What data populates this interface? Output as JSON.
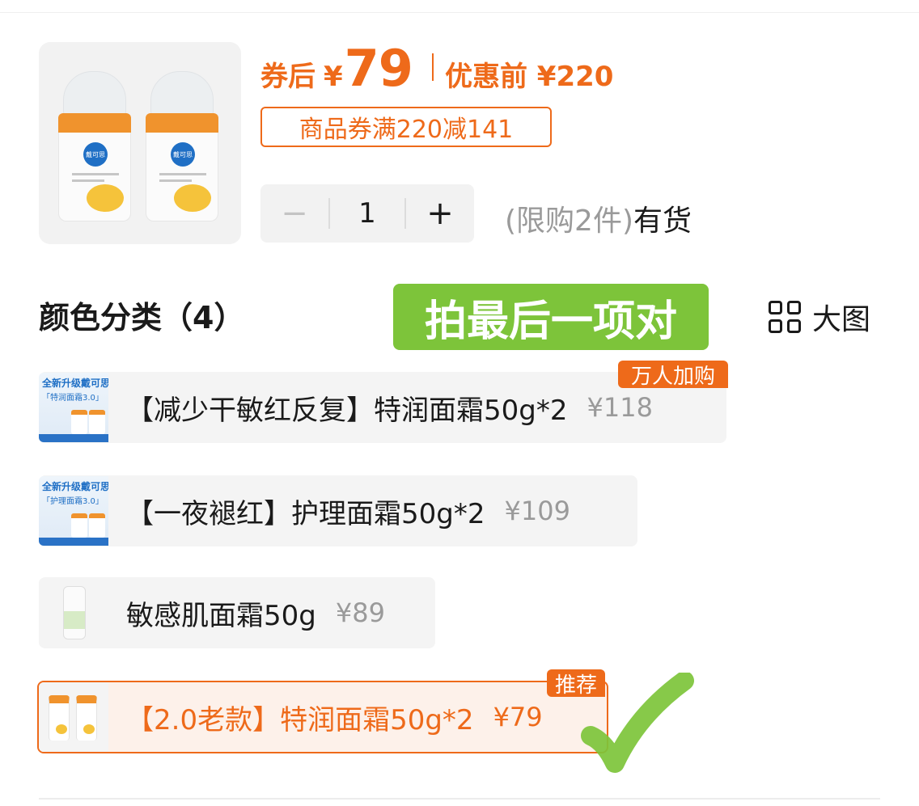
{
  "product": {
    "brand_label": "戴可思",
    "image_icon": "product-jars-image"
  },
  "price": {
    "after_coupon_label": "券后",
    "yen": "¥",
    "after_coupon_value": "79",
    "before_label": "优惠前 ¥220",
    "coupon": "商品券满220减141"
  },
  "quantity": {
    "minus": "−",
    "value": "1",
    "plus": "+",
    "limit": "(限购2件)",
    "stock": "有货"
  },
  "section": {
    "title": "颜色分类（4）",
    "annotation": "拍最后一项对",
    "big_view_label": "大图",
    "big_view_icon": "grid-icon"
  },
  "options": [
    {
      "name": "【减少干敏红反复】特润面霜50g*2",
      "price": "¥118",
      "badge": "万人加购",
      "thumb_title": "全新升级戴可思",
      "thumb_sub": "「特润面霜3.0」"
    },
    {
      "name": "【一夜褪红】护理面霜50g*2",
      "price": "¥109",
      "badge": "",
      "thumb_title": "全新升级戴可思",
      "thumb_sub": "「护理面霜3.0」"
    },
    {
      "name": "敏感肌面霜50g",
      "price": "¥89",
      "badge": ""
    },
    {
      "name": "【2.0老款】特润面霜50g*2",
      "price": "¥79",
      "badge": "推荐"
    }
  ],
  "colors": {
    "accent": "#ee6a1a",
    "annotation_green": "#7dc43a",
    "muted": "#9a9a9a"
  }
}
